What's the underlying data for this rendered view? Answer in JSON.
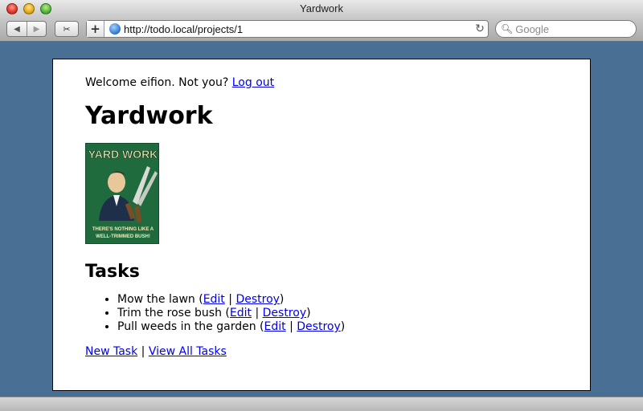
{
  "window": {
    "title": "Yardwork"
  },
  "toolbar": {
    "url": "http://todo.local/projects/1",
    "search_placeholder": "Google"
  },
  "header": {
    "welcome_text": "Welcome eifion. Not you?",
    "logout_label": "Log out"
  },
  "project": {
    "title": "Yardwork",
    "image_alt_text": [
      "YARD WORK",
      "THERE'S NOTHING LIKE A",
      "WELL-TRIMMED BUSH!"
    ]
  },
  "tasks": {
    "heading": "Tasks",
    "items": [
      {
        "name": "Mow the lawn",
        "edit_label": "Edit",
        "destroy_label": "Destroy"
      },
      {
        "name": "Trim the rose bush",
        "edit_label": "Edit",
        "destroy_label": "Destroy"
      },
      {
        "name": "Pull weeds in the garden",
        "edit_label": "Edit",
        "destroy_label": "Destroy"
      }
    ]
  },
  "footer": {
    "new_task_label": "New Task",
    "separator": "|",
    "view_all_label": "View All Tasks"
  },
  "colors": {
    "desktop_bg": "#4a6f94",
    "link": "#0000ee",
    "poster_green": "#1f6b3e"
  }
}
